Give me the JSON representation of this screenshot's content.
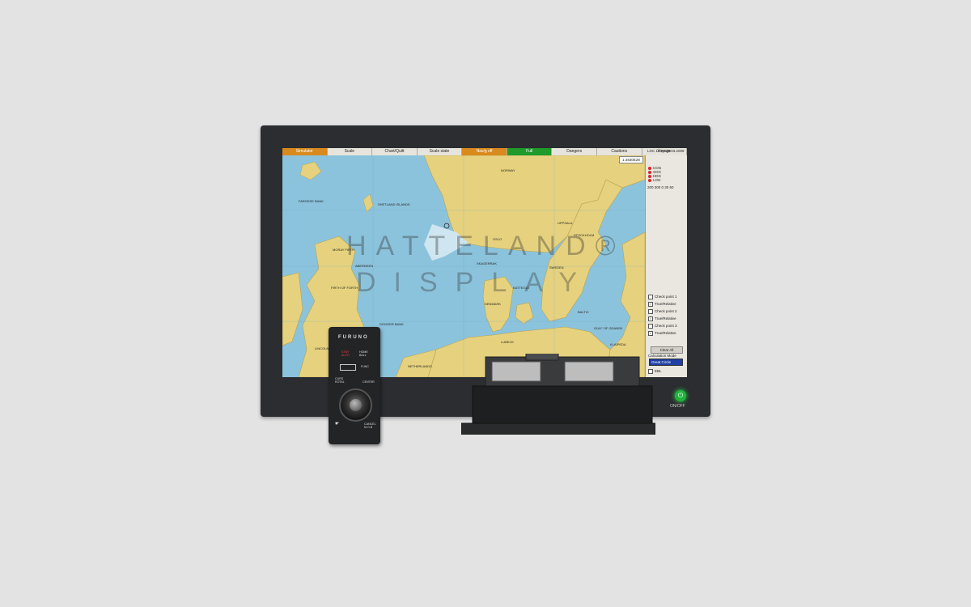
{
  "menu": [
    {
      "label": "Simulator",
      "style": "orange"
    },
    {
      "label": "Scale",
      "style": ""
    },
    {
      "label": "Chart/Quilt",
      "style": ""
    },
    {
      "label": "Scale state",
      "style": ""
    },
    {
      "label": "Nav/g off",
      "style": "orange"
    },
    {
      "label": "Full",
      "style": "green"
    },
    {
      "label": "Dangers",
      "style": ""
    },
    {
      "label": "Cautions",
      "style": ""
    },
    {
      "label": "Voyage",
      "style": ""
    }
  ],
  "panel": {
    "loc": "LOC 12:29 29.03.2009",
    "coord": "1.4830E28",
    "sensors": [
      "COG",
      "SOG",
      "HDG",
      "LOG"
    ],
    "scale_values": "200 300  0  30  60",
    "checks": [
      {
        "label": "Check point 1",
        "checked": false
      },
      {
        "label": "True/Relative",
        "checked": true
      },
      {
        "label": "Check point 2",
        "checked": false
      },
      {
        "label": "True/Relative",
        "checked": true
      },
      {
        "label": "Check point 3",
        "checked": false
      },
      {
        "label": "True/Relative",
        "checked": true
      }
    ],
    "clear_all": "Clear All",
    "calc_mode_label": "Calculation Mode",
    "calc_mode_value": "Great Circle",
    "ebl_label": "EBL"
  },
  "map_labels": {
    "shetland": "SHETLAND ISLANDS",
    "faroese": "FAROESE BANK",
    "skagerrak": "SKAGERRAK",
    "kattegat": "KATTEGAT",
    "denmark": "DENMARK",
    "baltic": "BALTIC",
    "norway": "NORWAY",
    "sweden": "SWEDEN",
    "moray": "MORAY FIRTH",
    "forth": "FIRTH OF FORTH",
    "dogger": "DOGGER BANK",
    "netherlands": "NETHERLANDS",
    "lubeck": "LUBECK",
    "gdansk": "GULF OF GDANSK",
    "klaipeda": "KLAIPEDA",
    "aberdeen": "ABERDEEN",
    "lincoln": "LINCOLN",
    "uppsala": "UPPSALA",
    "stockholm": "STOCKHOLM",
    "oslo": "OSLO"
  },
  "watermark": {
    "line1": "HATTELAND®",
    "line2": "DISPLAY"
  },
  "monitor": {
    "power_label": "ON/OFF"
  },
  "remote": {
    "brand": "FURUNO",
    "btn1": "STBY\nAUTO",
    "btn2": "HOME\nBALL",
    "btn3": "FUNC",
    "btn4": "CURS\nROTAL",
    "btn5": "CENTER",
    "btn6": "CANCEL\nM.O.B"
  }
}
